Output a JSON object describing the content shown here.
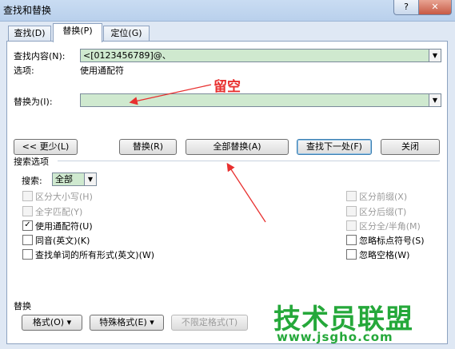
{
  "window": {
    "title": "查找和替换",
    "help_label": "?",
    "close_label": "✕"
  },
  "tabs": [
    {
      "label": "查找(D)"
    },
    {
      "label": "替换(P)"
    },
    {
      "label": "定位(G)"
    }
  ],
  "find": {
    "label": "查找内容(N):",
    "value": "<[0123456789]@、",
    "options_label": "选项:",
    "options_value": "使用通配符"
  },
  "replace": {
    "label": "替换为(I):",
    "value": ""
  },
  "annotation": {
    "text": "留空",
    "color": "#e8302f"
  },
  "buttons": {
    "less": "<< 更少(L)",
    "replace": "替换(R)",
    "replace_all": "全部替换(A)",
    "find_next": "查找下一处(F)",
    "close": "关闭"
  },
  "search_options": {
    "section_label": "搜索选项",
    "search_label": "搜索:",
    "search_value": "全部",
    "left_checks": [
      {
        "label": "区分大小写(H)",
        "checked": false,
        "enabled": false
      },
      {
        "label": "全字匹配(Y)",
        "checked": false,
        "enabled": false
      },
      {
        "label": "使用通配符(U)",
        "checked": true,
        "enabled": true
      },
      {
        "label": "同音(英文)(K)",
        "checked": false,
        "enabled": true
      },
      {
        "label": "查找单词的所有形式(英文)(W)",
        "checked": false,
        "enabled": true
      }
    ],
    "right_checks": [
      {
        "label": "区分前缀(X)",
        "checked": false,
        "enabled": false
      },
      {
        "label": "区分后缀(T)",
        "checked": false,
        "enabled": false
      },
      {
        "label": "区分全/半角(M)",
        "checked": false,
        "enabled": false
      },
      {
        "label": "忽略标点符号(S)",
        "checked": false,
        "enabled": true
      },
      {
        "label": "忽略空格(W)",
        "checked": false,
        "enabled": true
      }
    ]
  },
  "replace_section": {
    "label": "替换",
    "format": "格式(O) ▾",
    "special": "特殊格式(E) ▾",
    "no_format": "不限定格式(T)"
  },
  "watermark": {
    "title": "技术员联盟",
    "url": "www.jsgho.com",
    "color": "#25a83a"
  },
  "colors": {
    "field_bg": "#cfe9cf",
    "accent": "#3c7fb1"
  }
}
